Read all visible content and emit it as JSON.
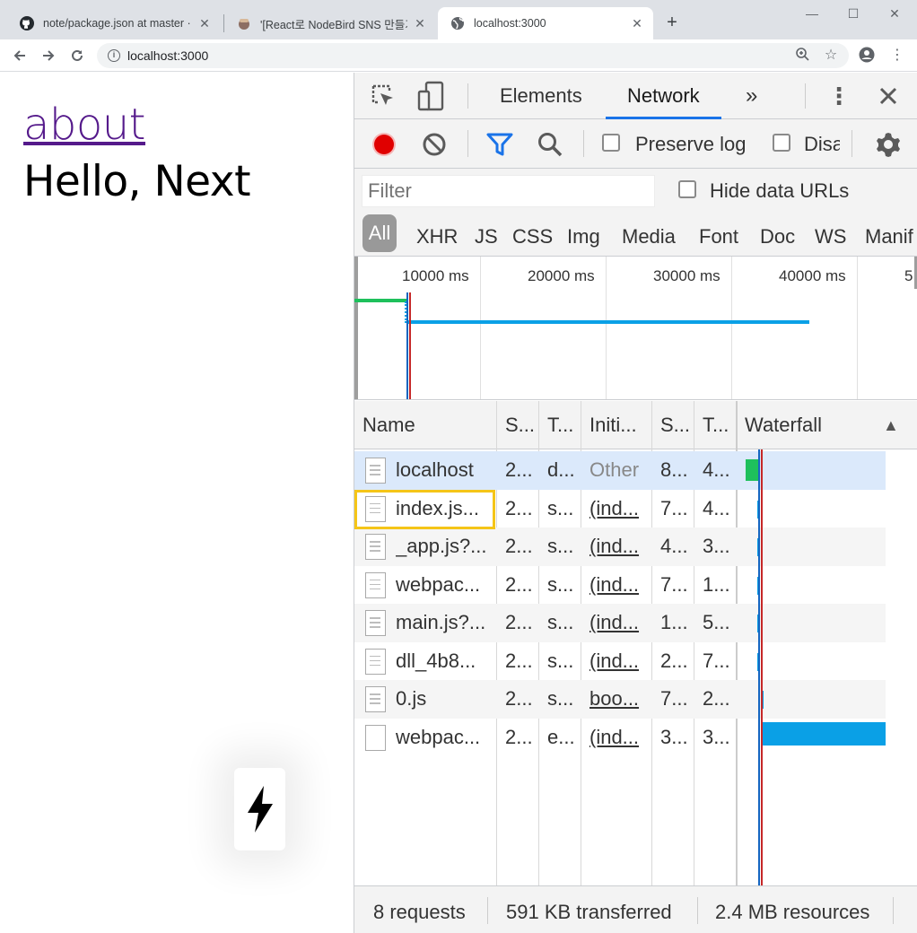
{
  "browser": {
    "tabs": [
      {
        "title": "note/package.json at master · p",
        "icon": "github-icon",
        "active": false
      },
      {
        "title": "'[React로 NodeBird SNS 만들기]",
        "icon": "course-thumbnail-icon",
        "active": false
      },
      {
        "title": "localhost:3000",
        "icon": "globe-icon",
        "active": true
      }
    ],
    "new_tab_glyph": "+",
    "address": "localhost:3000"
  },
  "page": {
    "link_text": "about",
    "heading": "Hello, Next"
  },
  "devtools": {
    "tabs": [
      "Elements",
      "Network"
    ],
    "active_tab": "Network",
    "more_tabs_glyph": "»",
    "preserve_log_label": "Preserve log",
    "disable_cache_label": "Disa",
    "filter_placeholder": "Filter",
    "hide_data_urls_label": "Hide data URLs",
    "type_filters": [
      "All",
      "XHR",
      "JS",
      "CSS",
      "Img",
      "Media",
      "Font",
      "Doc",
      "WS",
      "Manif"
    ],
    "overview_ticks": [
      "10000 ms",
      "20000 ms",
      "30000 ms",
      "40000 ms",
      "5"
    ],
    "columns": [
      "Name",
      "S...",
      "T...",
      "Initi...",
      "S...",
      "T...",
      "Waterfall"
    ],
    "sort_glyph": "▲",
    "requests": [
      {
        "name": "localhost",
        "status": "2...",
        "type": "d...",
        "initiator": "Other",
        "size": "8...",
        "time": "4..."
      },
      {
        "name": "index.js...",
        "status": "2...",
        "type": "s...",
        "initiator": "(ind...",
        "size": "7...",
        "time": "4..."
      },
      {
        "name": "_app.js?...",
        "status": "2...",
        "type": "s...",
        "initiator": "(ind...",
        "size": "4...",
        "time": "3..."
      },
      {
        "name": "webpac...",
        "status": "2...",
        "type": "s...",
        "initiator": "(ind...",
        "size": "7...",
        "time": "1..."
      },
      {
        "name": "main.js?...",
        "status": "2...",
        "type": "s...",
        "initiator": "(ind...",
        "size": "1...",
        "time": "5..."
      },
      {
        "name": "dll_4b8...",
        "status": "2...",
        "type": "s...",
        "initiator": "(ind...",
        "size": "2...",
        "time": "7..."
      },
      {
        "name": "0.js",
        "status": "2...",
        "type": "s...",
        "initiator": "boo...",
        "size": "7...",
        "time": "2..."
      },
      {
        "name": "webpac...",
        "status": "2...",
        "type": "e...",
        "initiator": "(ind...",
        "size": "3...",
        "time": "3..."
      }
    ],
    "status": {
      "requests": "8 requests",
      "transferred": "591 KB transferred",
      "resources": "2.4 MB resources"
    }
  },
  "colors": {
    "record_red": "#e00000",
    "filter_blue": "#1a73e8",
    "highlight_yellow": "#f5c518",
    "waterfall_green": "#1ec05c",
    "waterfall_blue": "#0aa0e6",
    "link_purple": "#551a8b"
  }
}
